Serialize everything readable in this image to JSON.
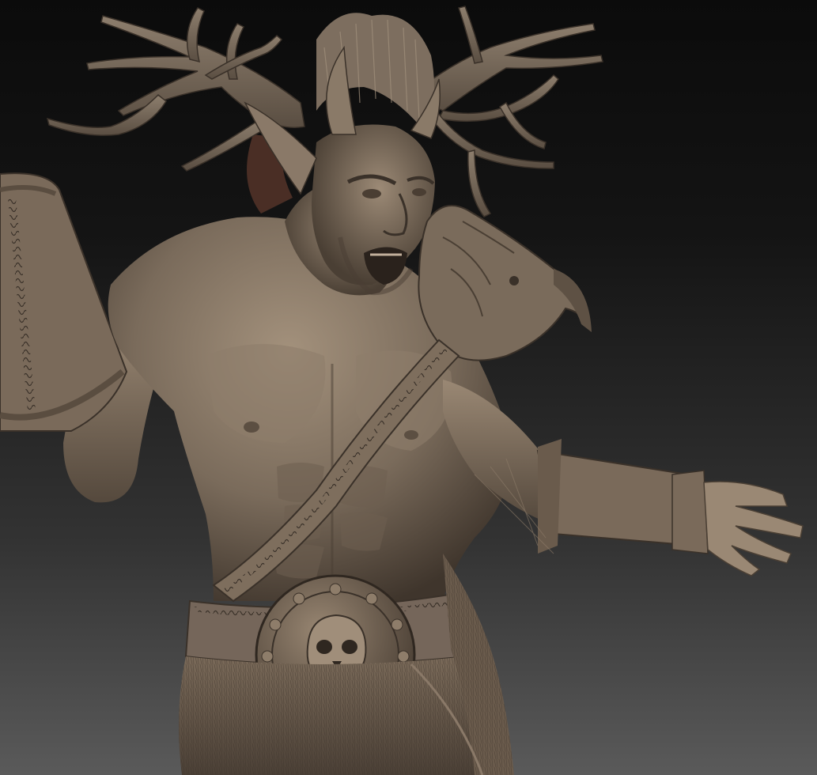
{
  "scene": {
    "subject": "sculpt-render",
    "background": {
      "top": "#0b0b0b",
      "mid": "#1f1f1f",
      "bottom": "#5a5a5a"
    },
    "material": {
      "base": "#6f6253",
      "light": "#a4927d",
      "highlight": "#c6b4a0",
      "shadow": "#3a3129",
      "dark": "#241e19"
    },
    "hair_color": "#4a2e25"
  }
}
